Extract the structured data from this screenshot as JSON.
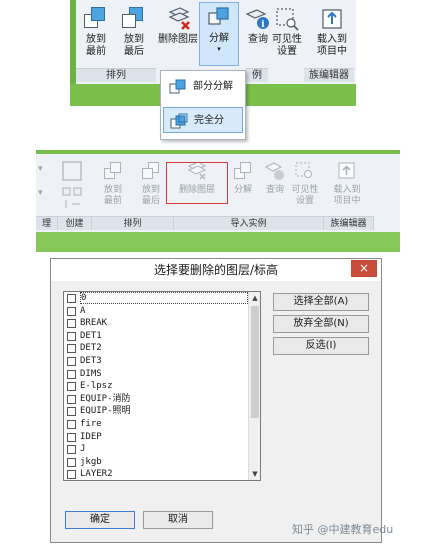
{
  "ribbon1": {
    "buttons": [
      {
        "label": "放到\n最前"
      },
      {
        "label": "放到\n最后"
      },
      {
        "label": "删除图层"
      },
      {
        "label": "分解"
      },
      {
        "label": "查询"
      },
      {
        "label": "可见性\n设置"
      },
      {
        "label": "载入到\n项目中"
      }
    ],
    "groups": {
      "arrange": "排列",
      "import": "例",
      "family_editor": "族编辑器"
    },
    "menu": [
      {
        "label": "部分分解"
      },
      {
        "label": "完全分"
      }
    ]
  },
  "ribbon2": {
    "buttons": [
      {
        "label": "放到\n最前"
      },
      {
        "label": "放到\n最后"
      },
      {
        "label": "删除图层"
      },
      {
        "label": "分解"
      },
      {
        "label": "查询"
      },
      {
        "label": "可见性\n设置"
      },
      {
        "label": "载入到\n项目中"
      }
    ],
    "groups": {
      "left": "理",
      "create": "创建",
      "arrange": "排列",
      "import": "导入实例",
      "family_editor": "族编辑器"
    }
  },
  "dialog": {
    "title": "选择要删除的图层/标高",
    "close": "×",
    "layers": [
      "0",
      "A",
      "BREAK",
      "DET1",
      "DET2",
      "DET3",
      "DIMS",
      "E-lpsz",
      "EQUIP-消防",
      "EQUIP-照明",
      "fire",
      "IDEP",
      "J",
      "jkgb",
      "LAYER2"
    ],
    "select_all": "选择全部(A)",
    "deselect_all": "放弃全部(N)",
    "invert": "反选(I)",
    "ok": "确定",
    "cancel": "取消"
  },
  "watermark": "知乎 @中建教育edu"
}
